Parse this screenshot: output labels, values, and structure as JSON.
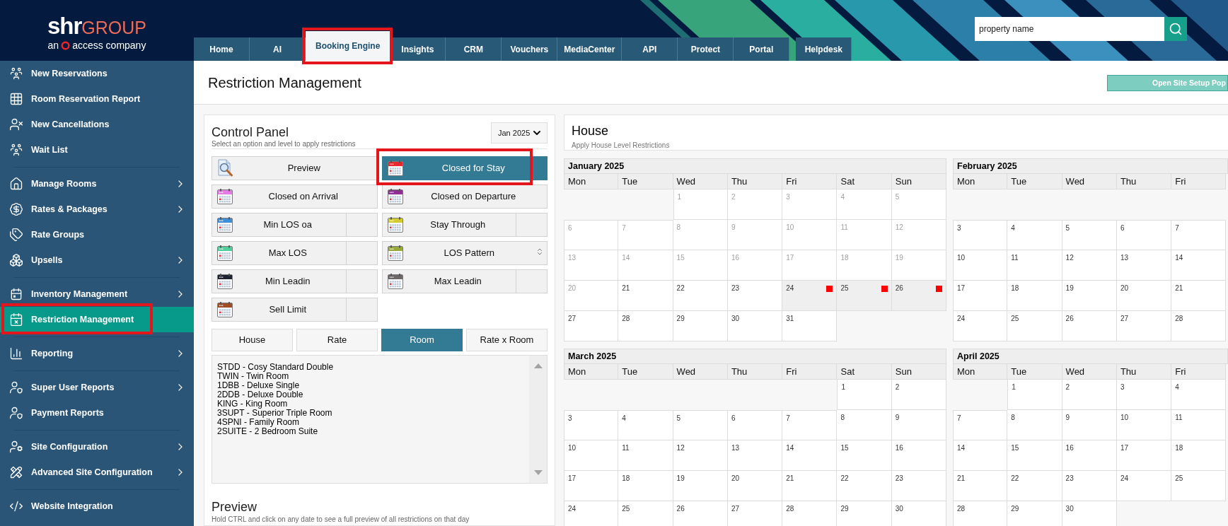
{
  "header": {
    "logo": {
      "brand": "shr",
      "suffix": "GROUP",
      "tagline_prefix": "an",
      "tagline": "access company"
    },
    "search": {
      "placeholder": "property name"
    }
  },
  "nav": {
    "tabs": [
      {
        "label": "Home",
        "selected": false,
        "highlighted": false
      },
      {
        "label": "AI",
        "selected": false,
        "highlighted": false
      },
      {
        "label": "Booking Engine",
        "selected": true,
        "highlighted": true
      },
      {
        "label": "Insights",
        "selected": false,
        "highlighted": false
      },
      {
        "label": "CRM",
        "selected": false,
        "highlighted": false
      },
      {
        "label": "Vouchers",
        "selected": false,
        "highlighted": false
      },
      {
        "label": "MediaCenter",
        "selected": false,
        "highlighted": false
      },
      {
        "label": "API",
        "selected": false,
        "highlighted": false
      },
      {
        "label": "Protect",
        "selected": false,
        "highlighted": false
      },
      {
        "label": "Portal",
        "selected": false,
        "highlighted": false
      }
    ],
    "secondary_tabs": [
      {
        "label": "Helpdesk",
        "selected": false,
        "highlighted": false
      }
    ]
  },
  "sidebar": {
    "groups": [
      {
        "items": [
          {
            "label": "New Reservations",
            "selected": false,
            "expandable": false,
            "highlighted": false
          },
          {
            "label": "Room Reservation Report",
            "selected": false,
            "expandable": false,
            "highlighted": false
          },
          {
            "label": "New Cancellations",
            "selected": false,
            "expandable": false,
            "highlighted": false
          },
          {
            "label": "Wait List",
            "selected": false,
            "expandable": false,
            "highlighted": false
          }
        ]
      },
      {
        "items": [
          {
            "label": "Manage Rooms",
            "selected": false,
            "expandable": true,
            "highlighted": false
          },
          {
            "label": "Rates & Packages",
            "selected": false,
            "expandable": true,
            "highlighted": false
          },
          {
            "label": "Rate Groups",
            "selected": false,
            "expandable": false,
            "highlighted": false
          },
          {
            "label": "Upsells",
            "selected": false,
            "expandable": true,
            "highlighted": false
          }
        ]
      },
      {
        "items": [
          {
            "label": "Inventory Management",
            "selected": false,
            "expandable": true,
            "highlighted": false
          },
          {
            "label": "Restriction Management",
            "selected": true,
            "expandable": false,
            "highlighted": true
          }
        ]
      },
      {
        "items": [
          {
            "label": "Reporting",
            "selected": false,
            "expandable": true,
            "highlighted": false
          }
        ]
      },
      {
        "items": [
          {
            "label": "Super User Reports",
            "selected": false,
            "expandable": true,
            "highlighted": false
          },
          {
            "label": "Payment Reports",
            "selected": false,
            "expandable": false,
            "highlighted": false
          }
        ]
      },
      {
        "items": [
          {
            "label": "Site Configuration",
            "selected": false,
            "expandable": true,
            "highlighted": false
          },
          {
            "label": "Advanced Site Configuration",
            "selected": false,
            "expandable": true,
            "highlighted": false
          }
        ]
      },
      {
        "items": [
          {
            "label": "Website Integration",
            "selected": false,
            "expandable": false,
            "highlighted": false
          }
        ]
      }
    ]
  },
  "page": {
    "title": "Restriction Management",
    "action_button": "Open Site Setup Pop"
  },
  "control_panel": {
    "title": "Control Panel",
    "subtitle": "Select an option and level to apply restrictions",
    "month_select": "Jan 2025",
    "options": [
      {
        "kind": "preview",
        "label": "Preview",
        "selected": false,
        "highlighted": false
      },
      {
        "kind": "toggle",
        "label": "Closed for Stay",
        "color": "#e8262b",
        "selected": true,
        "highlighted": true
      },
      {
        "kind": "toggle",
        "label": "Closed on Arrival",
        "color": "#e77ae6",
        "selected": false,
        "highlighted": false
      },
      {
        "kind": "toggle",
        "label": "Closed on Departure",
        "color": "#8e2f94",
        "selected": false,
        "highlighted": false
      },
      {
        "kind": "input",
        "label": "Min LOS oa",
        "color": "#3e8fd8",
        "selected": false,
        "highlighted": false
      },
      {
        "kind": "input",
        "label": "Stay Through",
        "color": "#d2cc2e",
        "selected": false,
        "highlighted": false
      },
      {
        "kind": "input",
        "label": "Max LOS",
        "color": "#4fcf9c",
        "selected": false,
        "highlighted": false
      },
      {
        "kind": "select",
        "label": "LOS Pattern",
        "color": "#98a83d",
        "selected": false,
        "highlighted": false
      },
      {
        "kind": "input",
        "label": "Min Leadin",
        "color": "#1f2230",
        "selected": false,
        "highlighted": false
      },
      {
        "kind": "input",
        "label": "Max Leadin",
        "color": "#6d6767",
        "selected": false,
        "highlighted": false
      },
      {
        "kind": "input",
        "label": "Sell Limit",
        "color": "#a24d24",
        "selected": false,
        "highlighted": false
      }
    ],
    "levels": [
      {
        "label": "House",
        "selected": false
      },
      {
        "label": "Rate",
        "selected": false
      },
      {
        "label": "Room",
        "selected": true
      },
      {
        "label": "Rate x Room",
        "selected": false
      }
    ],
    "rooms": [
      {
        "label": "STDD - Cosy Standard Double",
        "selected": false
      },
      {
        "label": "TWIN - Twin Room",
        "selected": false
      },
      {
        "label": "1DBB - Deluxe Single",
        "selected": false
      },
      {
        "label": "2DDB - Deluxe Double",
        "selected": false
      },
      {
        "label": "KING - King Room",
        "selected": false
      },
      {
        "label": "3SUPT - Superior Triple Room",
        "selected": false
      },
      {
        "label": "4SPNI - Family Room",
        "selected": false
      },
      {
        "label": "2SUITE - 2 Bedroom Suite",
        "selected": false
      }
    ],
    "preview": {
      "title": "Preview",
      "hint": "Hold CTRL and click on any date to see a full preview of all restrictions on that day"
    }
  },
  "calendar": {
    "title": "House",
    "subtitle": "Apply House Level Restrictions",
    "months": [
      {
        "title": "January 2025",
        "weekdays": [
          "Mon",
          "Tue",
          "Wed",
          "Thu",
          "Fri",
          "Sat",
          "Sun"
        ],
        "weeks": [
          [
            {
              "kind": "blank"
            },
            {
              "kind": "blank"
            },
            {
              "kind": "day",
              "day": "1",
              "past": true,
              "closed": false
            },
            {
              "kind": "day",
              "day": "2",
              "past": true,
              "closed": false
            },
            {
              "kind": "day",
              "day": "3",
              "past": true,
              "closed": false
            },
            {
              "kind": "day",
              "day": "4",
              "past": true,
              "closed": false
            },
            {
              "kind": "day",
              "day": "5",
              "past": true,
              "closed": false
            }
          ],
          [
            {
              "kind": "day",
              "day": "6",
              "past": true,
              "closed": false
            },
            {
              "kind": "day",
              "day": "7",
              "past": true,
              "closed": false
            },
            {
              "kind": "day",
              "day": "8",
              "past": true,
              "closed": false
            },
            {
              "kind": "day",
              "day": "9",
              "past": true,
              "closed": false
            },
            {
              "kind": "day",
              "day": "10",
              "past": true,
              "closed": false
            },
            {
              "kind": "day",
              "day": "11",
              "past": true,
              "closed": false
            },
            {
              "kind": "day",
              "day": "12",
              "past": true,
              "closed": false
            }
          ],
          [
            {
              "kind": "day",
              "day": "13",
              "past": true,
              "closed": false
            },
            {
              "kind": "day",
              "day": "14",
              "past": true,
              "closed": false
            },
            {
              "kind": "day",
              "day": "15",
              "past": true,
              "closed": false
            },
            {
              "kind": "day",
              "day": "16",
              "past": true,
              "closed": false
            },
            {
              "kind": "day",
              "day": "17",
              "past": true,
              "closed": false
            },
            {
              "kind": "day",
              "day": "18",
              "past": true,
              "closed": false
            },
            {
              "kind": "day",
              "day": "19",
              "past": true,
              "closed": false
            }
          ],
          [
            {
              "kind": "day",
              "day": "20",
              "past": true,
              "closed": false
            },
            {
              "kind": "day",
              "day": "21",
              "past": false,
              "closed": false
            },
            {
              "kind": "day",
              "day": "22",
              "past": false,
              "closed": false
            },
            {
              "kind": "day",
              "day": "23",
              "past": false,
              "closed": false
            },
            {
              "kind": "day",
              "day": "24",
              "past": false,
              "closed": true
            },
            {
              "kind": "day",
              "day": "25",
              "past": false,
              "closed": true
            },
            {
              "kind": "day",
              "day": "26",
              "past": false,
              "closed": true
            }
          ],
          [
            {
              "kind": "day",
              "day": "27",
              "past": false,
              "closed": false
            },
            {
              "kind": "day",
              "day": "28",
              "past": false,
              "closed": false
            },
            {
              "kind": "day",
              "day": "29",
              "past": false,
              "closed": false
            },
            {
              "kind": "day",
              "day": "30",
              "past": false,
              "closed": false
            },
            {
              "kind": "day",
              "day": "31",
              "past": false,
              "closed": false
            },
            {
              "kind": "blank"
            },
            {
              "kind": "blank"
            }
          ]
        ]
      },
      {
        "title": "February 2025",
        "weekdays": [
          "Mon",
          "Tue",
          "Wed",
          "Thu",
          "Fri"
        ],
        "weeks": [
          [
            {
              "kind": "blank"
            },
            {
              "kind": "blank"
            },
            {
              "kind": "blank"
            },
            {
              "kind": "blank"
            },
            {
              "kind": "blank"
            }
          ],
          [
            {
              "kind": "day",
              "day": "3",
              "past": false,
              "closed": false
            },
            {
              "kind": "day",
              "day": "4",
              "past": false,
              "closed": false
            },
            {
              "kind": "day",
              "day": "5",
              "past": false,
              "closed": false
            },
            {
              "kind": "day",
              "day": "6",
              "past": false,
              "closed": false
            },
            {
              "kind": "day",
              "day": "7",
              "past": false,
              "closed": false
            }
          ],
          [
            {
              "kind": "day",
              "day": "10",
              "past": false,
              "closed": false
            },
            {
              "kind": "day",
              "day": "11",
              "past": false,
              "closed": false
            },
            {
              "kind": "day",
              "day": "12",
              "past": false,
              "closed": false
            },
            {
              "kind": "day",
              "day": "13",
              "past": false,
              "closed": false
            },
            {
              "kind": "day",
              "day": "14",
              "past": false,
              "closed": false
            }
          ],
          [
            {
              "kind": "day",
              "day": "17",
              "past": false,
              "closed": false
            },
            {
              "kind": "day",
              "day": "18",
              "past": false,
              "closed": false
            },
            {
              "kind": "day",
              "day": "19",
              "past": false,
              "closed": false
            },
            {
              "kind": "day",
              "day": "20",
              "past": false,
              "closed": false
            },
            {
              "kind": "day",
              "day": "21",
              "past": false,
              "closed": false
            }
          ],
          [
            {
              "kind": "day",
              "day": "24",
              "past": false,
              "closed": false
            },
            {
              "kind": "day",
              "day": "25",
              "past": false,
              "closed": false
            },
            {
              "kind": "day",
              "day": "26",
              "past": false,
              "closed": false
            },
            {
              "kind": "day",
              "day": "27",
              "past": false,
              "closed": false
            },
            {
              "kind": "day",
              "day": "28",
              "past": false,
              "closed": false
            }
          ]
        ]
      },
      {
        "title": "March 2025",
        "weekdays": [
          "Mon",
          "Tue",
          "Wed",
          "Thu",
          "Fri",
          "Sat",
          "Sun"
        ],
        "weeks": [
          [
            {
              "kind": "blank"
            },
            {
              "kind": "blank"
            },
            {
              "kind": "blank"
            },
            {
              "kind": "blank"
            },
            {
              "kind": "blank"
            },
            {
              "kind": "day",
              "day": "1",
              "past": false,
              "closed": false
            },
            {
              "kind": "day",
              "day": "2",
              "past": false,
              "closed": false
            }
          ],
          [
            {
              "kind": "day",
              "day": "3",
              "past": false,
              "closed": false
            },
            {
              "kind": "day",
              "day": "4",
              "past": false,
              "closed": false
            },
            {
              "kind": "day",
              "day": "5",
              "past": false,
              "closed": false
            },
            {
              "kind": "day",
              "day": "6",
              "past": false,
              "closed": false
            },
            {
              "kind": "day",
              "day": "7",
              "past": false,
              "closed": false
            },
            {
              "kind": "day",
              "day": "8",
              "past": false,
              "closed": false
            },
            {
              "kind": "day",
              "day": "9",
              "past": false,
              "closed": false
            }
          ],
          [
            {
              "kind": "day",
              "day": "10",
              "past": false,
              "closed": false
            },
            {
              "kind": "day",
              "day": "11",
              "past": false,
              "closed": false
            },
            {
              "kind": "day",
              "day": "12",
              "past": false,
              "closed": false
            },
            {
              "kind": "day",
              "day": "13",
              "past": false,
              "closed": false
            },
            {
              "kind": "day",
              "day": "14",
              "past": false,
              "closed": false
            },
            {
              "kind": "day",
              "day": "15",
              "past": false,
              "closed": false
            },
            {
              "kind": "day",
              "day": "16",
              "past": false,
              "closed": false
            }
          ],
          [
            {
              "kind": "day",
              "day": "17",
              "past": false,
              "closed": false
            },
            {
              "kind": "day",
              "day": "18",
              "past": false,
              "closed": false
            },
            {
              "kind": "day",
              "day": "19",
              "past": false,
              "closed": false
            },
            {
              "kind": "day",
              "day": "20",
              "past": false,
              "closed": false
            },
            {
              "kind": "day",
              "day": "21",
              "past": false,
              "closed": false
            },
            {
              "kind": "day",
              "day": "22",
              "past": false,
              "closed": false
            },
            {
              "kind": "day",
              "day": "23",
              "past": false,
              "closed": false
            }
          ],
          [
            {
              "kind": "day",
              "day": "24",
              "past": false,
              "closed": false
            },
            {
              "kind": "day",
              "day": "25",
              "past": false,
              "closed": false
            },
            {
              "kind": "day",
              "day": "26",
              "past": false,
              "closed": false
            },
            {
              "kind": "day",
              "day": "27",
              "past": false,
              "closed": false
            },
            {
              "kind": "day",
              "day": "28",
              "past": false,
              "closed": false
            },
            {
              "kind": "day",
              "day": "29",
              "past": false,
              "closed": false
            },
            {
              "kind": "day",
              "day": "30",
              "past": false,
              "closed": false
            }
          ]
        ]
      },
      {
        "title": "April 2025",
        "weekdays": [
          "Mon",
          "Tue",
          "Wed",
          "Thu",
          "Fri"
        ],
        "weeks": [
          [
            {
              "kind": "blank"
            },
            {
              "kind": "day",
              "day": "1",
              "past": false,
              "closed": false
            },
            {
              "kind": "day",
              "day": "2",
              "past": false,
              "closed": false
            },
            {
              "kind": "day",
              "day": "3",
              "past": false,
              "closed": false
            },
            {
              "kind": "day",
              "day": "4",
              "past": false,
              "closed": false
            }
          ],
          [
            {
              "kind": "day",
              "day": "7",
              "past": false,
              "closed": false
            },
            {
              "kind": "day",
              "day": "8",
              "past": false,
              "closed": false
            },
            {
              "kind": "day",
              "day": "9",
              "past": false,
              "closed": false
            },
            {
              "kind": "day",
              "day": "10",
              "past": false,
              "closed": false
            },
            {
              "kind": "day",
              "day": "11",
              "past": false,
              "closed": false
            }
          ],
          [
            {
              "kind": "day",
              "day": "14",
              "past": false,
              "closed": false
            },
            {
              "kind": "day",
              "day": "15",
              "past": false,
              "closed": false
            },
            {
              "kind": "day",
              "day": "16",
              "past": false,
              "closed": false
            },
            {
              "kind": "day",
              "day": "17",
              "past": false,
              "closed": false
            },
            {
              "kind": "day",
              "day": "18",
              "past": false,
              "closed": false
            }
          ],
          [
            {
              "kind": "day",
              "day": "21",
              "past": false,
              "closed": false
            },
            {
              "kind": "day",
              "day": "22",
              "past": false,
              "closed": false
            },
            {
              "kind": "day",
              "day": "23",
              "past": false,
              "closed": false
            },
            {
              "kind": "day",
              "day": "24",
              "past": false,
              "closed": false
            },
            {
              "kind": "day",
              "day": "25",
              "past": false,
              "closed": false
            }
          ],
          [
            {
              "kind": "day",
              "day": "28",
              "past": false,
              "closed": false
            },
            {
              "kind": "day",
              "day": "29",
              "past": false,
              "closed": false
            },
            {
              "kind": "day",
              "day": "30",
              "past": false,
              "closed": false
            },
            {
              "kind": "blank"
            },
            {
              "kind": "blank"
            }
          ]
        ]
      }
    ]
  }
}
